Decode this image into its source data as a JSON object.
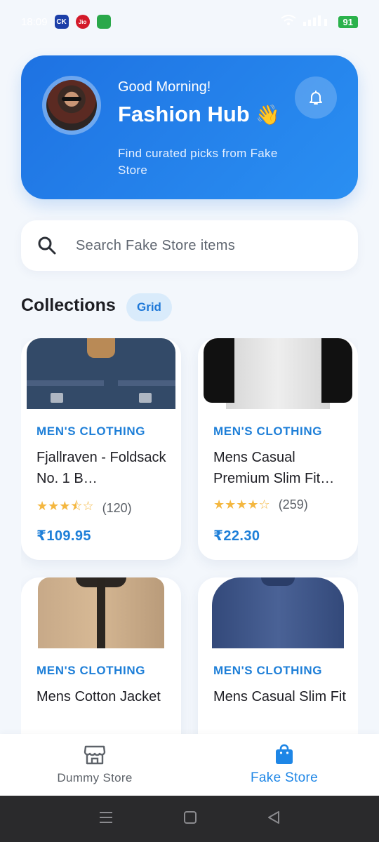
{
  "status_bar": {
    "time": "18:09",
    "app_icons": [
      "CK",
      "Jio"
    ],
    "battery": "91"
  },
  "header": {
    "greeting": "Good Morning!",
    "title": "Fashion Hub",
    "wave_emoji": "👋",
    "subtitle": "Find curated picks from Fake Store",
    "avatar_icon": "user-avatar",
    "bell_icon": "bell-icon",
    "accent_color": "#1e72e2"
  },
  "search": {
    "placeholder": "Search Fake Store items",
    "value": ""
  },
  "collections": {
    "title": "Collections",
    "view_chip": "Grid"
  },
  "products": [
    {
      "category": "MEN'S CLOTHING",
      "title": "Fjallraven - Foldsack No. 1 B…",
      "rating": 3.5,
      "rating_stars": "★★★⯪☆",
      "review_count": "(120)",
      "price": "₹109.95",
      "image": "backpack"
    },
    {
      "category": "MEN'S CLOTHING",
      "title": "Mens Casual Premium Slim Fit…",
      "rating": 4,
      "rating_stars": "★★★★☆",
      "review_count": "(259)",
      "price": "₹22.30",
      "image": "raglan-tshirt"
    },
    {
      "category": "MEN'S CLOTHING",
      "title": "Mens Cotton Jacket",
      "image": "cotton-jacket"
    },
    {
      "category": "MEN'S CLOTHING",
      "title": "Mens Casual Slim Fit",
      "image": "slim-fit-shirt"
    }
  ],
  "bottom_nav": {
    "items": [
      {
        "label": "Dummy Store",
        "icon": "store-icon",
        "active": false
      },
      {
        "label": "Fake Store",
        "icon": "shopping-bag-icon",
        "active": true
      }
    ]
  },
  "colors": {
    "price_blue": "#1e7fd8",
    "star": "#f4b740",
    "background": "#f3f7fc"
  }
}
